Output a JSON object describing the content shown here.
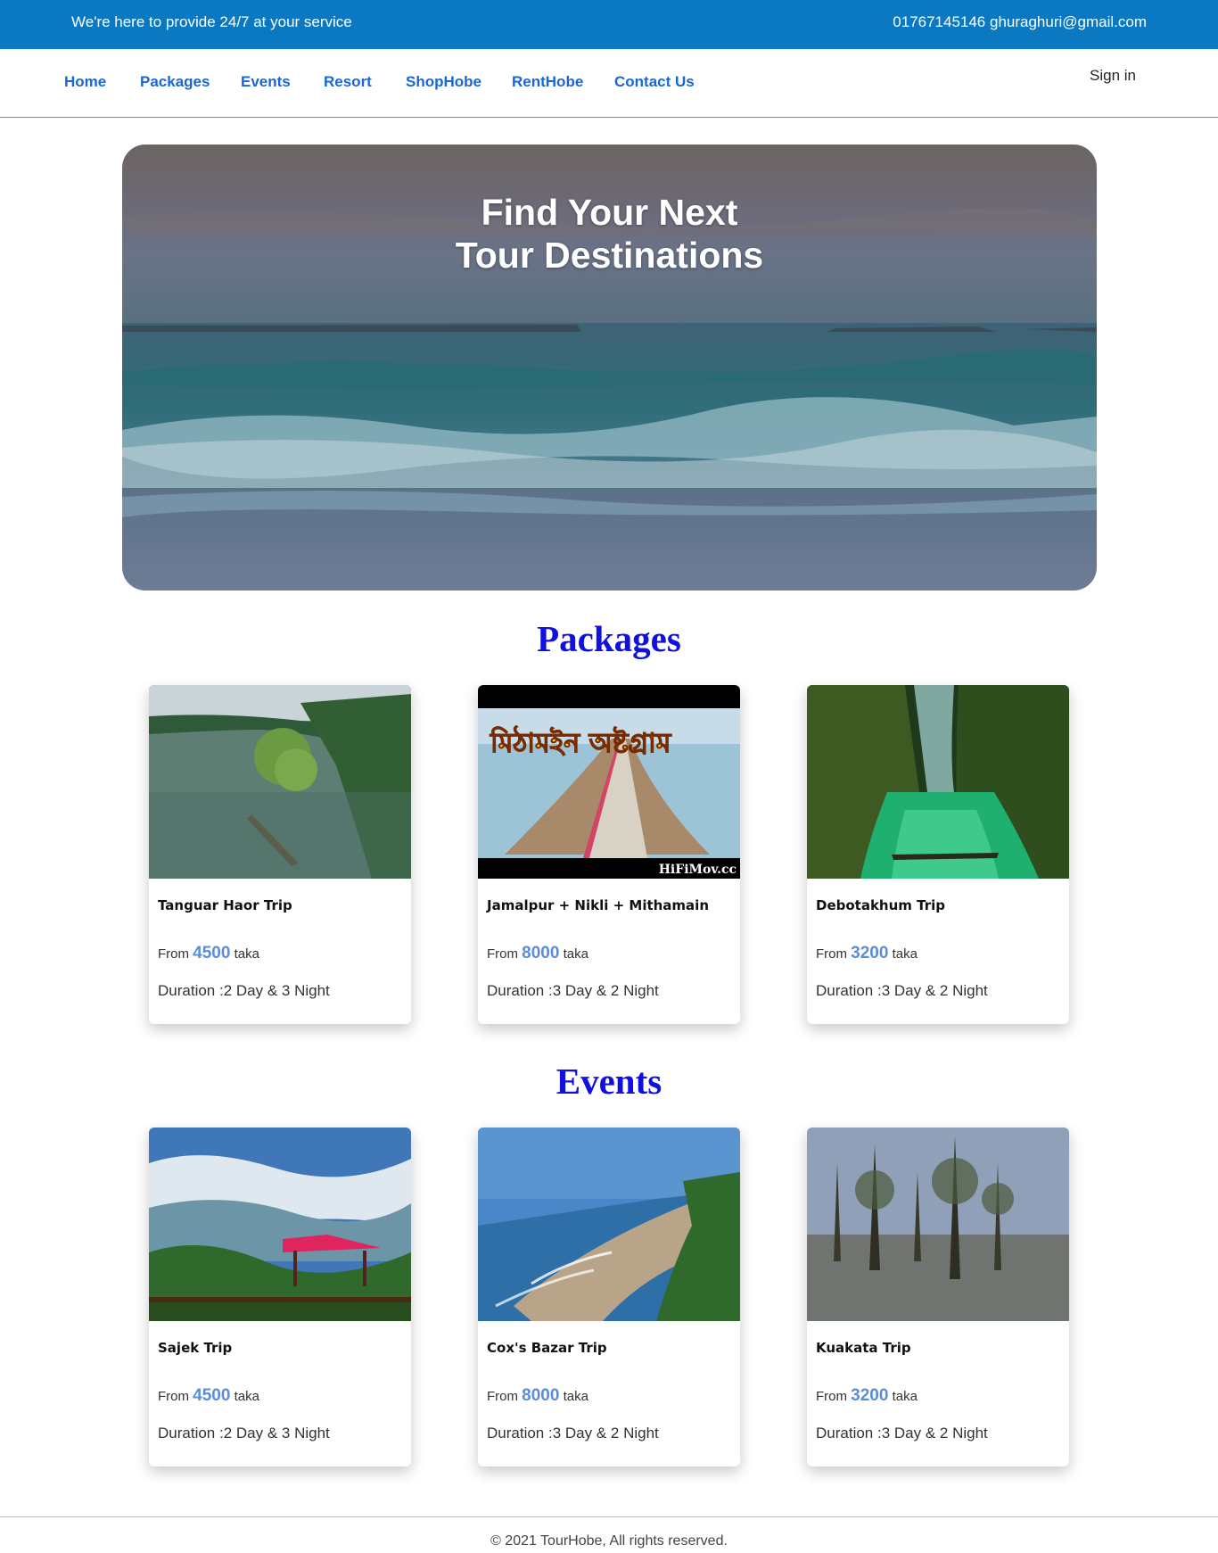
{
  "topbar": {
    "tagline": "We're here to provide 24/7 at your service",
    "contact": "01767145146 ghuraghuri@gmail.com"
  },
  "nav": {
    "items": [
      "Home",
      "Packages",
      "Events",
      "Resort",
      "ShopHobe",
      "RentHobe",
      "Contact Us"
    ],
    "signin": "Sign in"
  },
  "hero": {
    "line1": "Find Your Next",
    "line2": "Tour Destinations"
  },
  "packages": {
    "heading": "Packages",
    "cards": [
      {
        "title": "Tanguar Haor Trip",
        "from": "From ",
        "price": "4500",
        "unit": " taka",
        "duration": "Duration :2 Day & 3 Night"
      },
      {
        "title": "Jamalpur + Nikli + Mithamain",
        "from": "From ",
        "price": "8000",
        "unit": " taka",
        "duration": "Duration :3 Day & 2 Night",
        "img_text_bn": "মিঠামইন অষ্টগ্রাম",
        "img_watermark": "HiFiMov.cc"
      },
      {
        "title": "Debotakhum Trip",
        "from": "From ",
        "price": "3200",
        "unit": " taka",
        "duration": "Duration :3 Day & 2 Night"
      }
    ]
  },
  "events": {
    "heading": "Events",
    "cards": [
      {
        "title": "Sajek Trip",
        "from": "From ",
        "price": "4500",
        "unit": " taka",
        "duration": "Duration :2 Day & 3 Night"
      },
      {
        "title": "Cox's Bazar Trip",
        "from": "From ",
        "price": "8000",
        "unit": " taka",
        "duration": "Duration :3 Day & 2 Night"
      },
      {
        "title": "Kuakata Trip",
        "from": "From ",
        "price": "3200",
        "unit": " taka",
        "duration": "Duration :3 Day & 2 Night"
      }
    ]
  },
  "footer": {
    "text": "© 2021 TourHobe, All rights reserved."
  },
  "colors": {
    "topbar": "#0b78c2",
    "nav_link": "#1a66d6",
    "section_heading": "#1010e0",
    "price": "#5b8ed8"
  }
}
